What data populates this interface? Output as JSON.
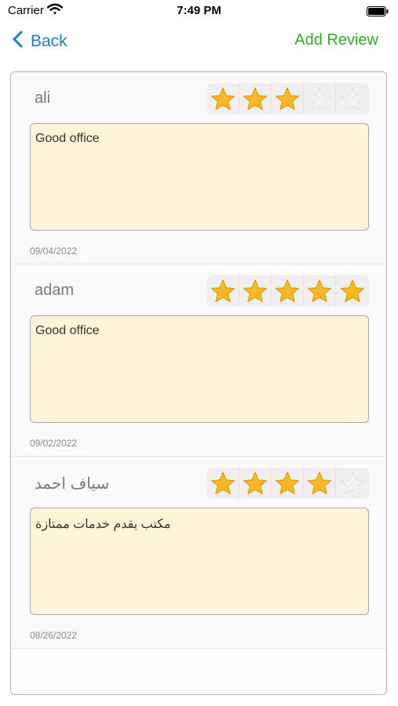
{
  "status": {
    "carrier": "Carrier",
    "time": "7:49 PM"
  },
  "nav": {
    "back_label": "Back",
    "add_review_label": "Add Review"
  },
  "colors": {
    "link_blue": "#1a7ae0",
    "add_green": "#2eb024",
    "star_filled": "#ffb820",
    "star_empty": "#f3f3f3",
    "text_box_bg": "#fef5d8"
  },
  "reviews": [
    {
      "name": "ali",
      "rating": 3,
      "max_rating": 5,
      "text": "Good office",
      "date": "09/04/2022"
    },
    {
      "name": "adam",
      "rating": 5,
      "max_rating": 5,
      "text": "Good office",
      "date": "09/02/2022"
    },
    {
      "name": "سياف احمد",
      "rating": 4,
      "max_rating": 5,
      "text": "مكتب يقدم خدمات ممتازة",
      "date": "08/26/2022"
    }
  ]
}
